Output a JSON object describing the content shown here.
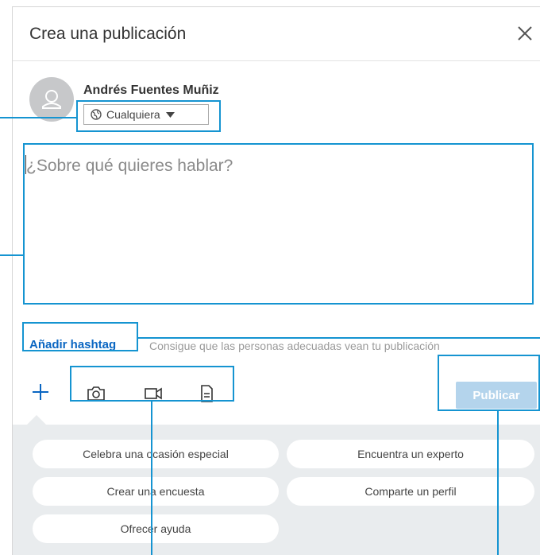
{
  "header": {
    "title": "Crea una publicación",
    "close_icon": "close-icon"
  },
  "author": {
    "avatar_icon": "user-silhouette-icon",
    "name": "Andrés Fuentes Muñiz",
    "visibility_label": "Cualquiera",
    "visibility_icon": "globe-icon"
  },
  "composer": {
    "placeholder": "¿Sobre qué quieres hablar?"
  },
  "hashtag": {
    "link_label": "Añadir hashtag",
    "hint": "Consigue que las personas adecuadas vean tu publicación"
  },
  "toolbar": {
    "add_icon": "plus-icon",
    "media_icons": [
      "camera-icon",
      "video-icon",
      "document-icon"
    ],
    "publish_label": "Publicar"
  },
  "suggestions": [
    "Celebra una ocasión especial",
    "Encuentra un experto",
    "Crear una encuesta",
    "Comparte un perfil",
    "Ofrecer ayuda"
  ],
  "colors": {
    "link": "#0a66c2",
    "callout": "#1594d1",
    "publish_disabled": "#b4d4ec",
    "suggestion_bg": "#e9ecee"
  }
}
